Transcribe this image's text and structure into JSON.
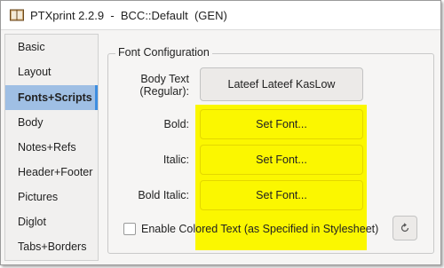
{
  "window": {
    "title": "PTXprint 2.2.9  -  BCC::Default  (GEN)",
    "app_icon": "book-icon"
  },
  "sidebar": {
    "items": [
      {
        "label": "Basic",
        "active": false
      },
      {
        "label": "Layout",
        "active": false
      },
      {
        "label": "Fonts+Scripts",
        "active": true
      },
      {
        "label": "Body",
        "active": false
      },
      {
        "label": "Notes+Refs",
        "active": false
      },
      {
        "label": "Header+Footer",
        "active": false
      },
      {
        "label": "Pictures",
        "active": false
      },
      {
        "label": "Diglot",
        "active": false
      },
      {
        "label": "Tabs+Borders",
        "active": false
      }
    ]
  },
  "font_config": {
    "legend": "Font Configuration",
    "body_label_line1": "Body Text",
    "body_label_line2": "(Regular):",
    "body_font": "Lateef Lateef KasLow",
    "bold_label": "Bold:",
    "bold_font": "Set Font...",
    "italic_label": "Italic:",
    "italic_font": "Set Font...",
    "bold_italic_label": "Bold Italic:",
    "bold_italic_font": "Set Font...",
    "colored_text_label": "Enable Colored Text (as Specified in Stylesheet)",
    "colored_text_checked": false,
    "reset_icon": "reset-icon"
  },
  "colors": {
    "highlight": "#fbf700",
    "active_tab": "#9fbfe4",
    "active_accent": "#3d8ee0"
  }
}
